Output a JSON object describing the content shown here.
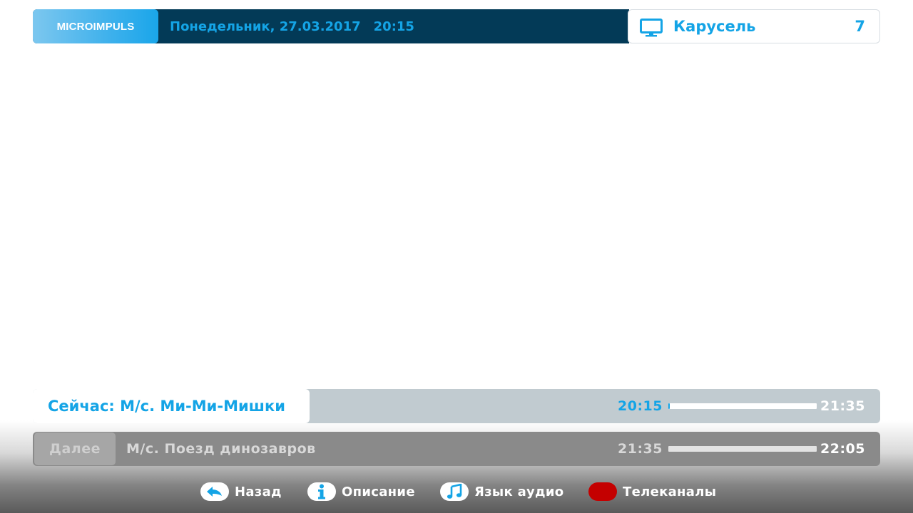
{
  "header": {
    "logo": "MICROIMPULS",
    "date": "Понедельник, 27.03.2017",
    "time": "20:15"
  },
  "channel": {
    "name": "Карусель",
    "number": "7",
    "icon": "tv-icon"
  },
  "now": {
    "label": "Сейчас: М/с. Ми-Ми-Мишки",
    "start": "20:15",
    "end": "21:35",
    "progress": 0.01
  },
  "next": {
    "tag": "Далее",
    "title": "М/с. Поезд динозавров",
    "start": "21:35",
    "end": "22:05",
    "progress": 0
  },
  "hints": [
    {
      "label": "Назад",
      "icon": "back-arrow-icon",
      "key_color": "#ffffff"
    },
    {
      "label": "Описание",
      "icon": "info-icon",
      "key_color": "#ffffff"
    },
    {
      "label": "Язык аудио",
      "icon": "music-note-icon",
      "key_color": "#ffffff"
    },
    {
      "label": "Телеканалы",
      "icon": "red-key-icon",
      "key_color": "#c40000"
    }
  ],
  "colors": {
    "accent": "#14a4e6",
    "header_bg": "#033a57",
    "now_row_bg": "#c1cbd0",
    "next_row_bg": "#8a8a8a"
  }
}
